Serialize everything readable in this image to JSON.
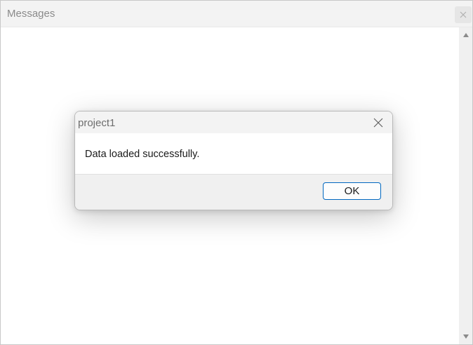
{
  "outer_window": {
    "title": "Messages",
    "close_icon": "close-icon",
    "scroll_up_icon": "arrow-up-icon",
    "scroll_down_icon": "arrow-down-icon"
  },
  "dialog": {
    "title": "project1",
    "message": "Data loaded successfully.",
    "ok_label": "OK",
    "close_icon": "close-icon"
  },
  "colors": {
    "accent": "#0067c0",
    "titlebar_bg": "#f3f3f3",
    "footer_bg": "#f0f0f0"
  }
}
